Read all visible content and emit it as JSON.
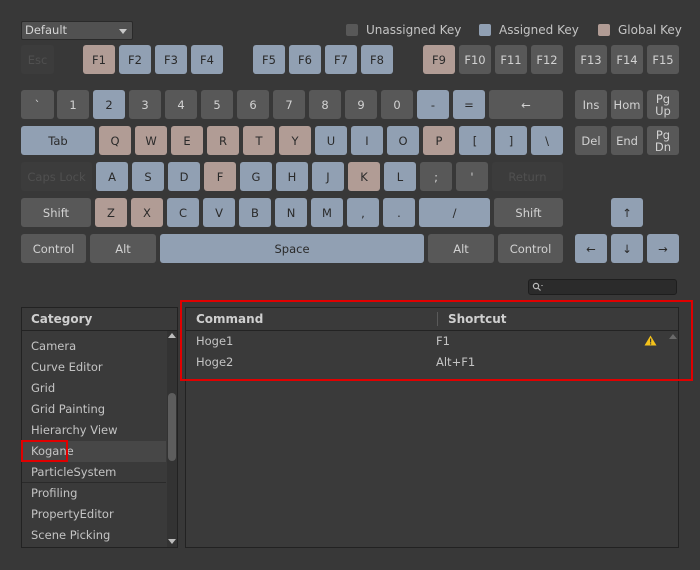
{
  "dropdown": {
    "value": "Default"
  },
  "legend": {
    "unassigned": "Unassigned Key",
    "assigned": "Assigned Key",
    "global": "Global Key"
  },
  "colors": {
    "unassigned": "#585858",
    "assigned": "#91a0b3",
    "global": "#b19c95",
    "disabled": "#3c3c3c"
  },
  "keys": {
    "esc": "Esc",
    "f1": "F1",
    "f2": "F2",
    "f3": "F3",
    "f4": "F4",
    "f5": "F5",
    "f6": "F6",
    "f7": "F7",
    "f8": "F8",
    "f9": "F9",
    "f10": "F10",
    "f11": "F11",
    "f12": "F12",
    "f13": "F13",
    "f14": "F14",
    "f15": "F15",
    "backquote": "`",
    "n1": "1",
    "n2": "2",
    "n3": "3",
    "n4": "4",
    "n5": "5",
    "n6": "6",
    "n7": "7",
    "n8": "8",
    "n9": "9",
    "n0": "0",
    "minus": "-",
    "equals": "=",
    "backspace": "←",
    "ins": "Ins",
    "home": "Hom",
    "pgup": "Pg\nUp",
    "tab": "Tab",
    "q": "Q",
    "w": "W",
    "e": "E",
    "r": "R",
    "t": "T",
    "y": "Y",
    "u": "U",
    "i": "I",
    "o": "O",
    "p": "P",
    "lbracket": "[",
    "rbracket": "]",
    "backslash": "\\",
    "del": "Del",
    "end": "End",
    "pgdn": "Pg\nDn",
    "capslock": "Caps Lock",
    "a": "A",
    "s": "S",
    "d": "D",
    "f": "F",
    "g": "G",
    "h": "H",
    "j": "J",
    "k": "K",
    "l": "L",
    "semicolon": ";",
    "quote": "'",
    "return": "Return",
    "lshift": "Shift",
    "z": "Z",
    "x": "X",
    "c": "C",
    "v": "V",
    "b": "B",
    "n": "N",
    "m": "M",
    "comma": ",",
    "period": ".",
    "slash": "/",
    "rshift": "Shift",
    "up": "↑",
    "lcontrol": "Control",
    "lalt": "Alt",
    "space": "Space",
    "ralt": "Alt",
    "rcontrol": "Control",
    "left": "←",
    "down": "↓",
    "right": "→"
  },
  "category": {
    "header": "Category",
    "items": [
      "Camera",
      "Curve Editor",
      "Grid",
      "Grid Painting",
      "Hierarchy View",
      "Kogane",
      "ParticleSystem",
      "Profiling",
      "PropertyEditor",
      "Scene Picking"
    ],
    "selected": "Kogane"
  },
  "commands": {
    "header_command": "Command",
    "header_shortcut": "Shortcut",
    "rows": [
      {
        "command": "Hoge1",
        "shortcut": "F1",
        "warning": "warning-icon"
      },
      {
        "command": "Hoge2",
        "shortcut": "Alt+F1"
      }
    ]
  }
}
